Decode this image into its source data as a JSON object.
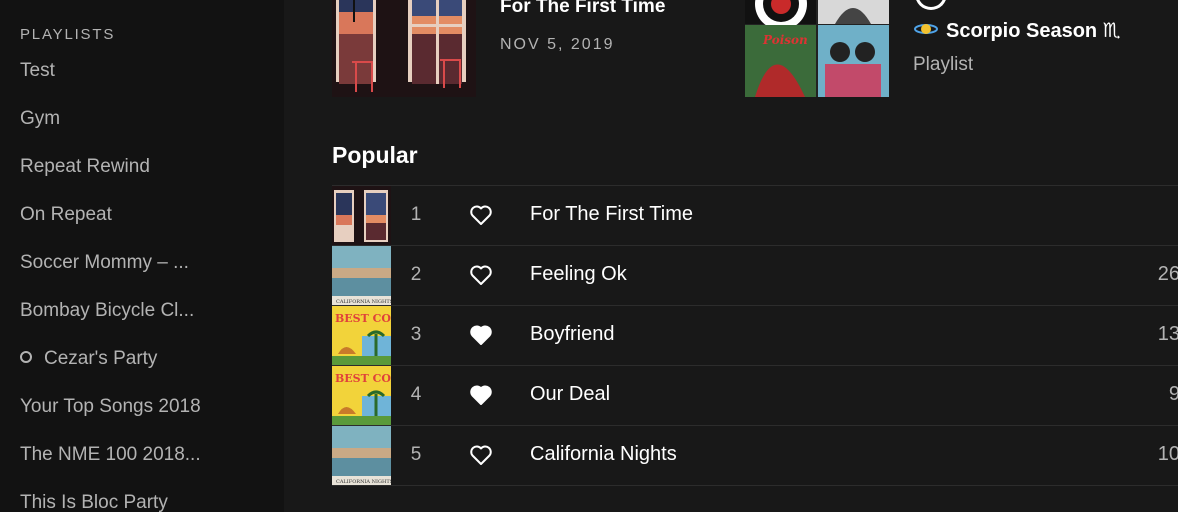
{
  "sidebar": {
    "header": "PLAYLISTS",
    "items": [
      {
        "label": "Test"
      },
      {
        "label": "Gym"
      },
      {
        "label": "Repeat Rewind"
      },
      {
        "label": "On Repeat"
      },
      {
        "label": "Soccer Mommy – ..."
      },
      {
        "label": "Bombay Bicycle Cl..."
      },
      {
        "label": "Cezar's Party",
        "indicator": "ring-dot"
      },
      {
        "label": "Your Top Songs 2018"
      },
      {
        "label": "The NME 100 2018..."
      },
      {
        "label": "This Is Bloc Party"
      }
    ]
  },
  "latest_release": {
    "title": "For The First Time",
    "date": "NOV 5, 2019"
  },
  "featured_playlist": {
    "title": "Scorpio Season ♏",
    "subtitle": "Playlist",
    "badge_icon": "spinning-planet-icon"
  },
  "popular": {
    "heading": "Popular",
    "tracks": [
      {
        "num": "1",
        "title": "For The First Time",
        "liked": false,
        "plays": "",
        "art": "windows-art"
      },
      {
        "num": "2",
        "title": "Feeling Ok",
        "liked": false,
        "plays": "26",
        "art": "california-nights-art"
      },
      {
        "num": "3",
        "title": "Boyfriend",
        "liked": true,
        "plays": "13",
        "art": "best-coast-art"
      },
      {
        "num": "4",
        "title": "Our Deal",
        "liked": true,
        "plays": "9",
        "art": "best-coast-art"
      },
      {
        "num": "5",
        "title": "California Nights",
        "liked": false,
        "plays": "10",
        "art": "california-nights-art"
      }
    ]
  },
  "colors": {
    "background": "#181818",
    "sidebar_bg": "#121212",
    "text_primary": "#ffffff",
    "text_secondary": "#b3b3b3",
    "divider": "#2c2c2c"
  }
}
